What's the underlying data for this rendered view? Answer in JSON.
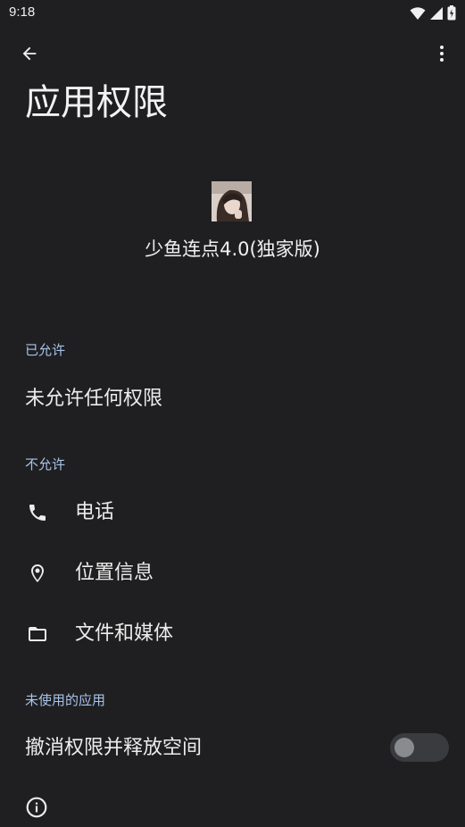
{
  "status_bar": {
    "time": "9:18",
    "icons": [
      "wifi-icon",
      "signal-icon",
      "battery-icon"
    ]
  },
  "toolbar": {
    "back_icon": "arrow-left-icon",
    "more_icon": "more-vert-icon"
  },
  "page": {
    "title": "应用权限"
  },
  "app": {
    "name": "少鱼连点4.0(独家版)"
  },
  "sections": {
    "allowed": {
      "header": "已允许",
      "empty_text": "未允许任何权限"
    },
    "denied": {
      "header": "不允许",
      "items": [
        {
          "label": "电话",
          "icon": "phone-icon"
        },
        {
          "label": "位置信息",
          "icon": "location-pin-icon"
        },
        {
          "label": "文件和媒体",
          "icon": "folder-icon"
        }
      ]
    },
    "unused": {
      "header": "未使用的应用",
      "toggle_label": "撤消权限并释放空间",
      "toggle_on": false
    }
  },
  "colors": {
    "background": "#1f1f21",
    "section_header": "#a8c3ea",
    "text": "#ececec"
  }
}
